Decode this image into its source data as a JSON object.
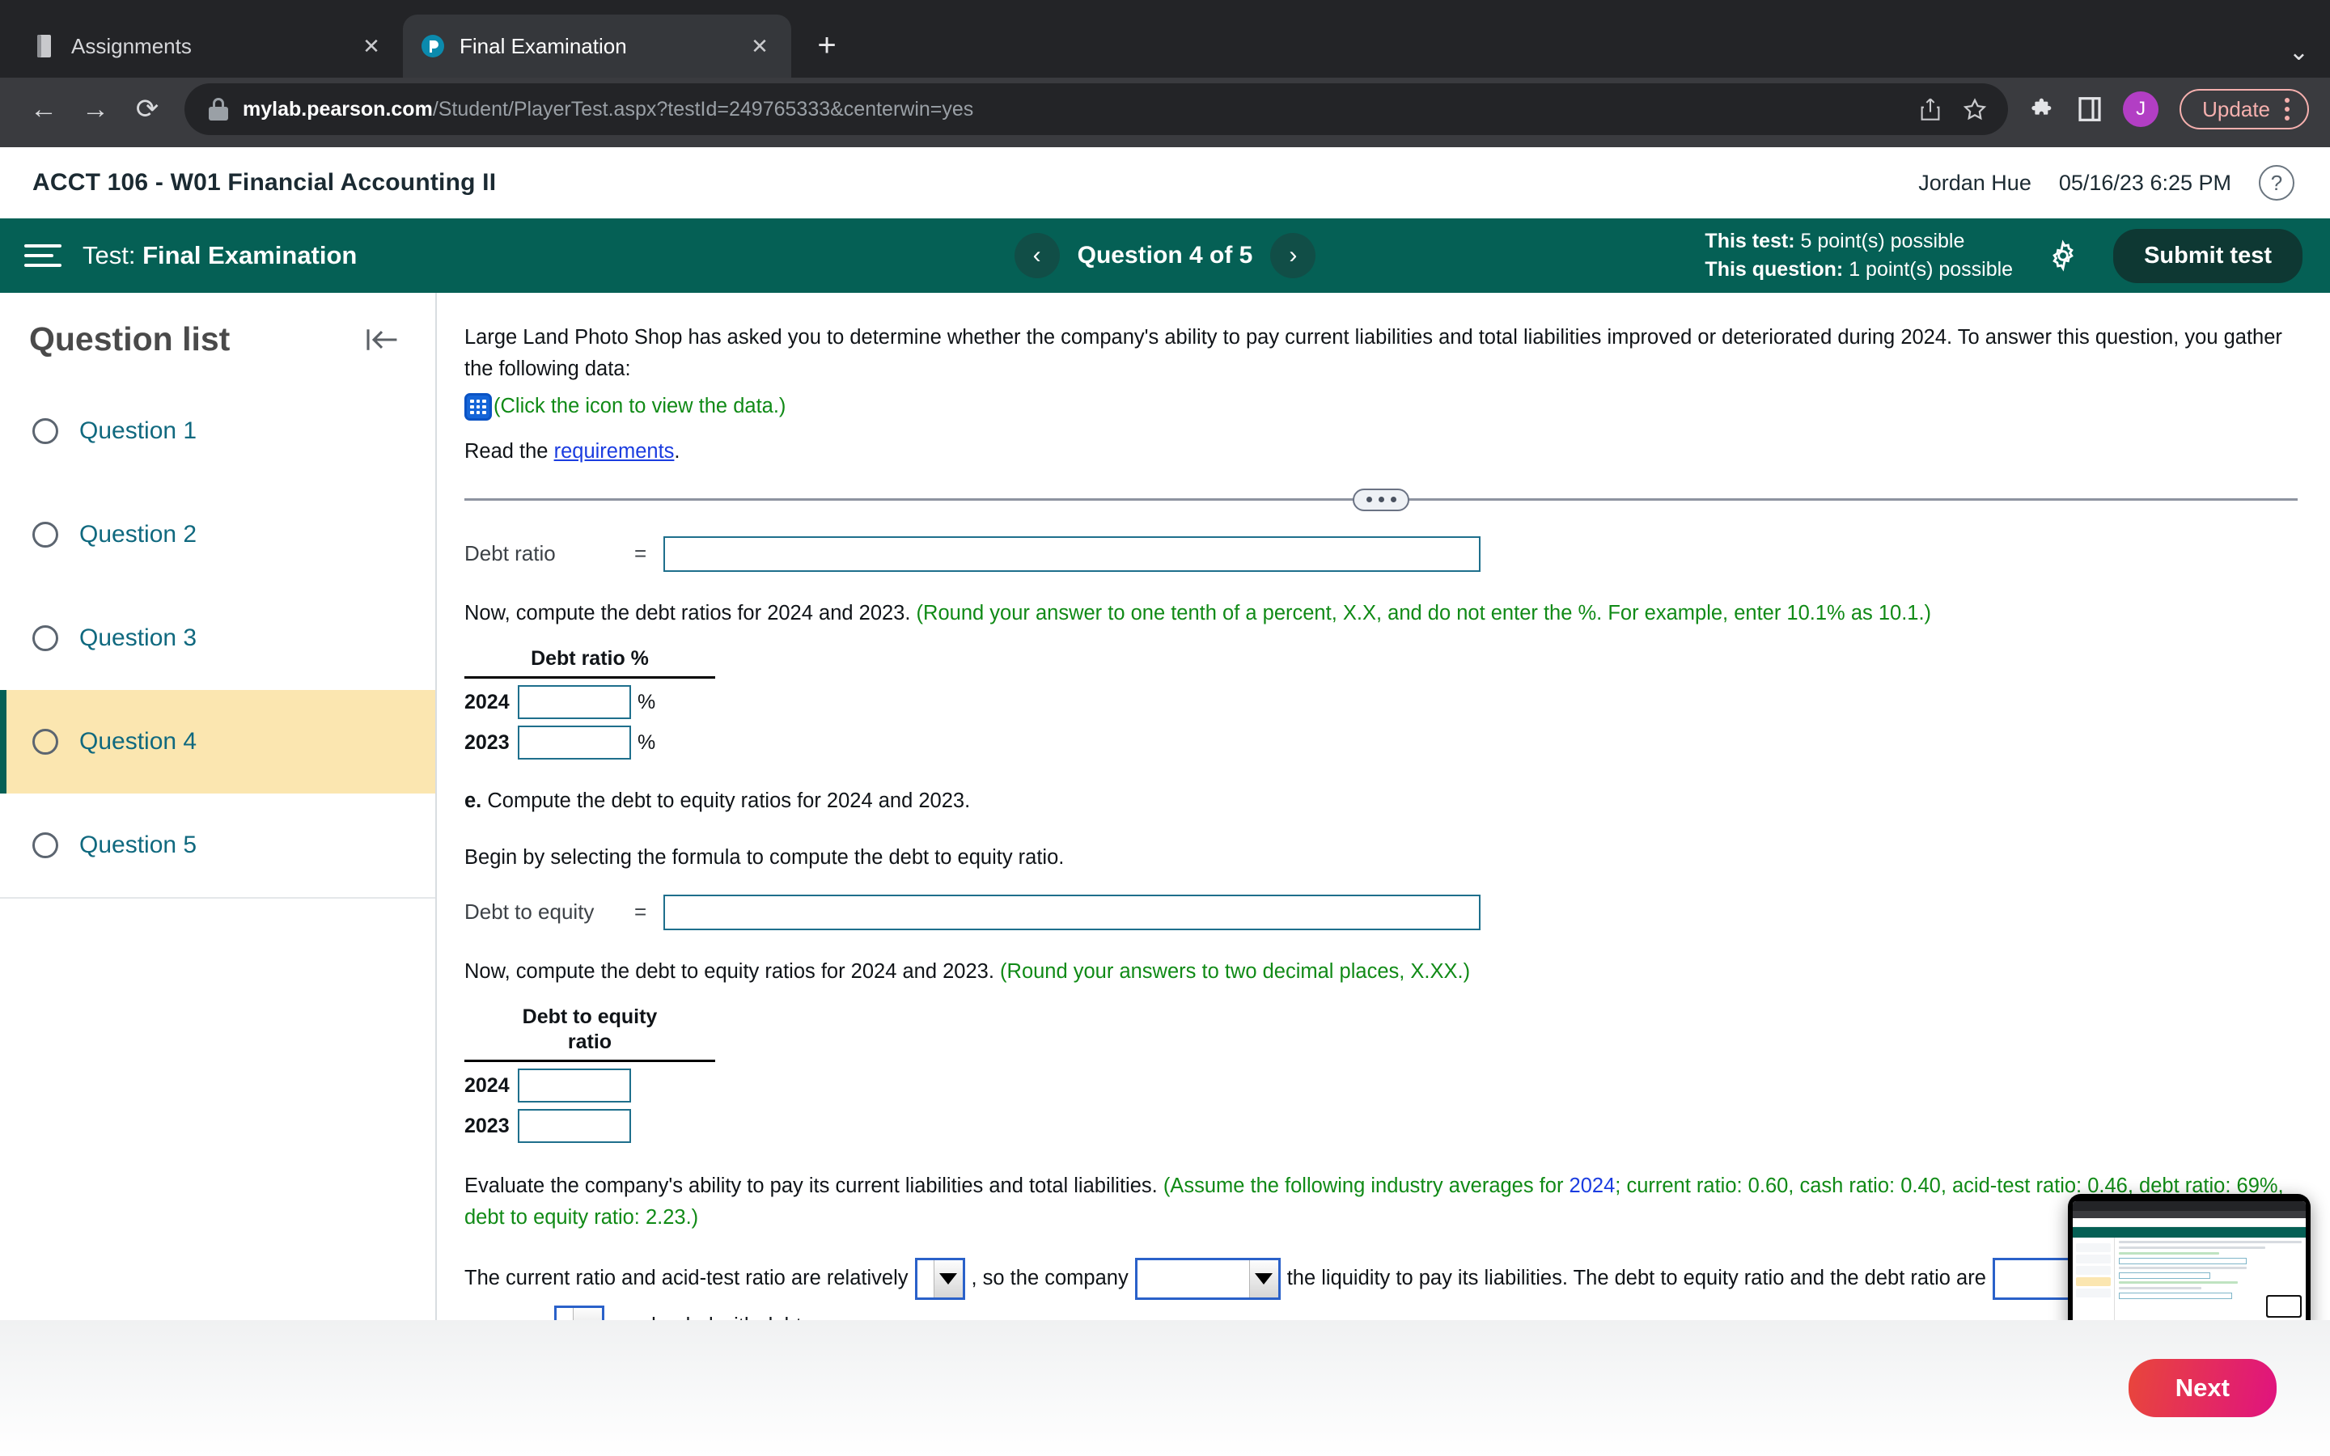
{
  "browser": {
    "tabs": [
      {
        "title": "Assignments",
        "favicon": "book-icon",
        "active": false
      },
      {
        "title": "Final Examination",
        "favicon": "pearson-icon",
        "active": true
      }
    ],
    "new_tab_label": "+",
    "tabstrip_chevron": "⌄",
    "back_label": "←",
    "forward_label": "→",
    "reload_label": "⟳",
    "url_domain": "mylab.pearson.com",
    "url_path": "/Student/PlayerTest.aspx?testId=249765333&centerwin=yes",
    "avatar_initial": "J",
    "update_label": "Update"
  },
  "course": {
    "title": "ACCT 106 - W01 Financial Accounting II",
    "user": "Jordan Hue",
    "timestamp": "05/16/23 6:25 PM",
    "help_label": "?"
  },
  "test_bar": {
    "test_prefix": "Test:",
    "test_name": "Final Examination",
    "prev_label": "‹",
    "next_label": "›",
    "question_counter": "Question 4 of 5",
    "points_test_label": "This test:",
    "points_test_value": "5 point(s) possible",
    "points_question_label": "This question:",
    "points_question_value": "1 point(s) possible",
    "submit_label": "Submit test"
  },
  "sidebar": {
    "title": "Question list",
    "collapse_label": "collapse-panel",
    "items": [
      {
        "label": "Question 1",
        "active": false
      },
      {
        "label": "Question 2",
        "active": false
      },
      {
        "label": "Question 3",
        "active": false
      },
      {
        "label": "Question 4",
        "active": true
      },
      {
        "label": "Question 5",
        "active": false
      }
    ]
  },
  "question": {
    "intro": "Large Land Photo Shop has asked you to determine whether the company's ability to pay current liabilities and total liabilities improved or deteriorated during 2024. To answer this question, you gather the following data:",
    "data_icon_note": "(Click the icon to view the data.)",
    "read_prefix": "Read the ",
    "read_link": "requirements",
    "read_suffix": ".",
    "debt_ratio_formula_label": "Debt ratio",
    "equals": "=",
    "debt_ratio_instruction": "Now, compute the debt ratios for 2024 and 2023. ",
    "debt_ratio_rounding": "(Round your answer to one tenth of a percent, X.X, and do not enter the %. For example, enter 10.1% as 10.1.)",
    "debt_ratio_table": {
      "header": "Debt ratio %",
      "rows": [
        {
          "year": "2024",
          "value": "",
          "unit": "%"
        },
        {
          "year": "2023",
          "value": "",
          "unit": "%"
        }
      ]
    },
    "part_e_letter": "e.",
    "part_e_text": " Compute the debt to equity ratios for 2024 and 2023.",
    "part_e_begin": "Begin by selecting the formula to compute the debt to equity ratio.",
    "debt_equity_formula_label": "Debt to equity",
    "debt_equity_instruction": "Now, compute the debt to equity ratios for 2024 and 2023. ",
    "debt_equity_rounding": "(Round your answers to two decimal places, X.XX.)",
    "debt_equity_table": {
      "header_line1": "Debt to equity",
      "header_line2": "ratio",
      "rows": [
        {
          "year": "2024",
          "value": ""
        },
        {
          "year": "2023",
          "value": ""
        }
      ]
    },
    "evaluate_text": "Evaluate the company's ability to pay its current liabilities and total liabilities. ",
    "evaluate_assume_pre": "(Assume the following industry averages for ",
    "evaluate_assume_year": "2024",
    "evaluate_assume_post": "; current ratio: 0.60, cash ratio: 0.40, acid-test ratio: 0.46, debt ratio: 69%, debt to equity ratio: 2.23.)",
    "sentence": {
      "part1": "The current ratio and acid-test ratio are relatively",
      "dropdown1_value": "",
      "part2": ", so the company",
      "dropdown2_value": "",
      "part3": "the liquidity to pay its liabilities. The debt to equity ratio and the debt ratio are",
      "dropdown3_value": "",
      "part4": "company",
      "dropdown4_value": "",
      "part5": "overloaded with debt."
    }
  },
  "footer": {
    "next_label": "Next"
  },
  "colors": {
    "brand_green": "#056055",
    "link_blue": "#10697f",
    "highlight_yellow": "#fbe6b0",
    "instruction_green": "#108a16",
    "input_border": "#1e6f8c",
    "dropdown_border": "#2a61c9",
    "next_gradient_from": "#e8463b",
    "next_gradient_to": "#e0137f"
  }
}
